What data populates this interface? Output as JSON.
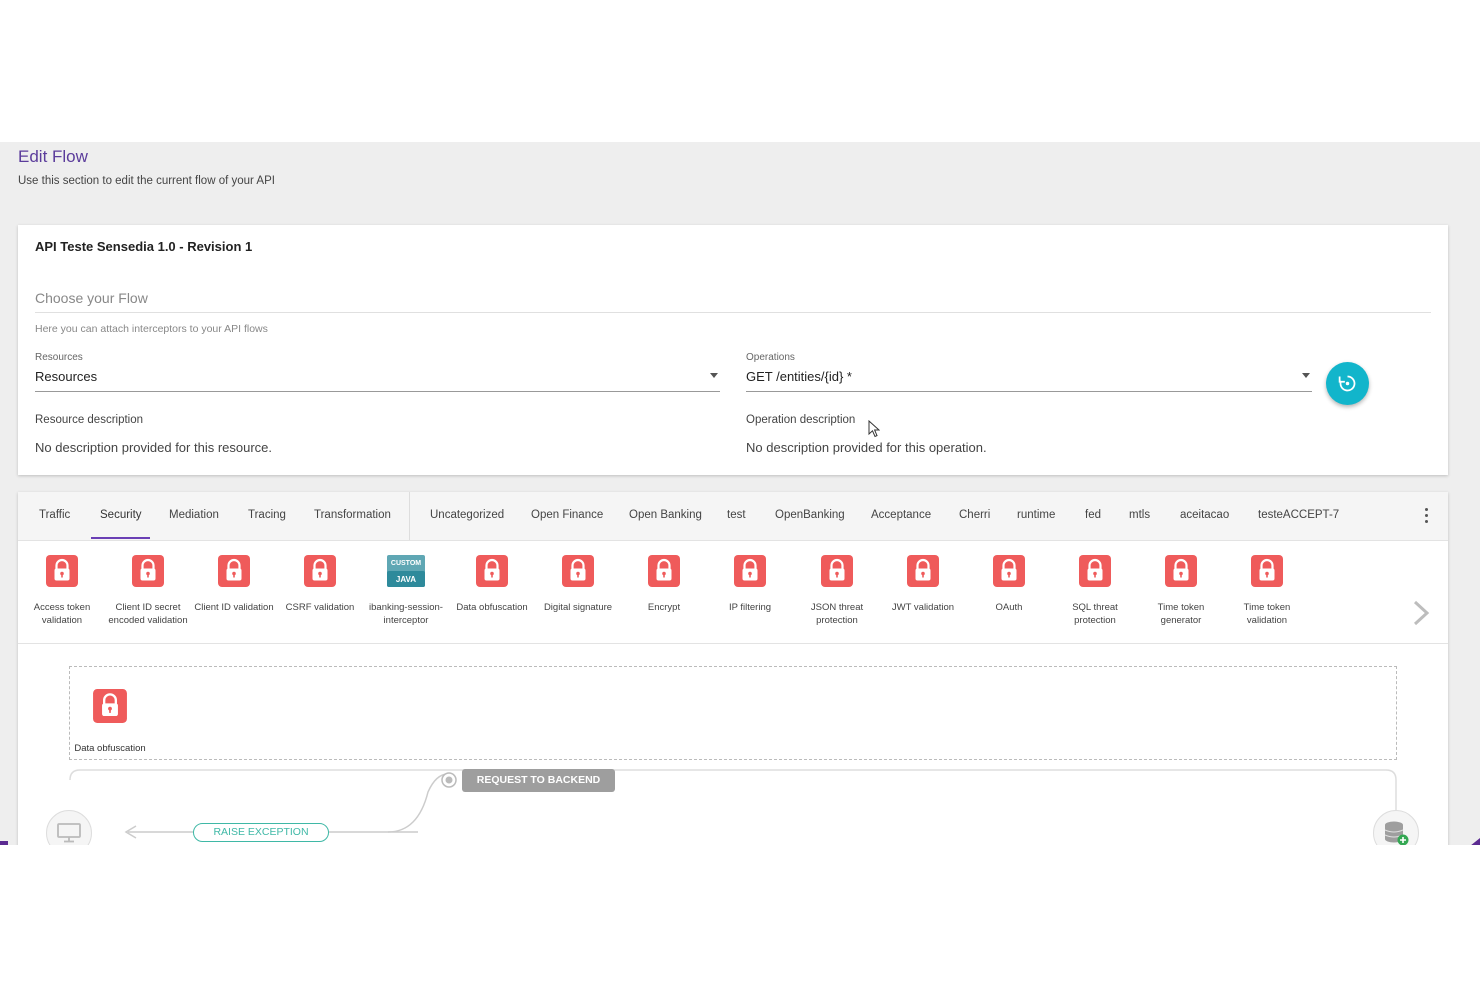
{
  "header": {
    "title": "Edit Flow",
    "subtitle": "Use this section to edit the current flow of your API"
  },
  "card": {
    "api_title": "API Teste Sensedia 1.0 - Revision 1",
    "choose_flow": "Choose your Flow",
    "hint": "Here you can attach interceptors to your API flows",
    "resources_label": "Resources",
    "resources_value": "Resources",
    "operations_label": "Operations",
    "operations_value": "GET /entities/{id} *",
    "resource_desc_label": "Resource description",
    "resource_desc": "No description provided for this resource.",
    "operation_desc_label": "Operation description",
    "operation_desc": "No description provided for this operation."
  },
  "tabs": [
    {
      "label": "Traffic"
    },
    {
      "label": "Security"
    },
    {
      "label": "Mediation"
    },
    {
      "label": "Tracing"
    },
    {
      "label": "Transformation"
    },
    {
      "label": "Uncategorized"
    },
    {
      "label": "Open Finance"
    },
    {
      "label": "Open Banking"
    },
    {
      "label": "test"
    },
    {
      "label": "OpenBanking"
    },
    {
      "label": "Acceptance"
    },
    {
      "label": "Cherri"
    },
    {
      "label": "runtime"
    },
    {
      "label": "fed"
    },
    {
      "label": "mtls"
    },
    {
      "label": "aceitacao"
    },
    {
      "label": "testeACCEPT-7"
    }
  ],
  "active_tab": "Security",
  "tools": [
    {
      "label": "Access token validation",
      "icon": "lock-icon"
    },
    {
      "label": "Client ID secret encoded validation",
      "icon": "lock-icon"
    },
    {
      "label": "Client ID validation",
      "icon": "lock-icon"
    },
    {
      "label": "CSRF validation",
      "icon": "lock-icon"
    },
    {
      "label": "ibanking-session-interceptor",
      "icon": "custom-java-icon"
    },
    {
      "label": "Data obfuscation",
      "icon": "lock-icon"
    },
    {
      "label": "Digital signature",
      "icon": "lock-icon"
    },
    {
      "label": "Encrypt",
      "icon": "lock-icon"
    },
    {
      "label": "IP filtering",
      "icon": "lock-icon"
    },
    {
      "label": "JSON threat protection",
      "icon": "lock-icon"
    },
    {
      "label": "JWT validation",
      "icon": "lock-icon"
    },
    {
      "label": "OAuth",
      "icon": "lock-icon"
    },
    {
      "label": "SQL threat protection",
      "icon": "lock-icon"
    },
    {
      "label": "Time token generator",
      "icon": "lock-icon"
    },
    {
      "label": "Time token validation",
      "icon": "lock-icon"
    }
  ],
  "custom_icon_text": {
    "top": "CUSTOM",
    "bottom": "JAVA"
  },
  "flow": {
    "dropped_label": "Data obfuscation",
    "request_to_backend": "REQUEST TO BACKEND",
    "raise_exception": "RAISE EXCEPTION"
  },
  "colors": {
    "accent_purple": "#5b3c9b",
    "lock_red": "#ef5b5b",
    "teal": "#12b5cb",
    "exception_green": "#3fb8a6"
  }
}
